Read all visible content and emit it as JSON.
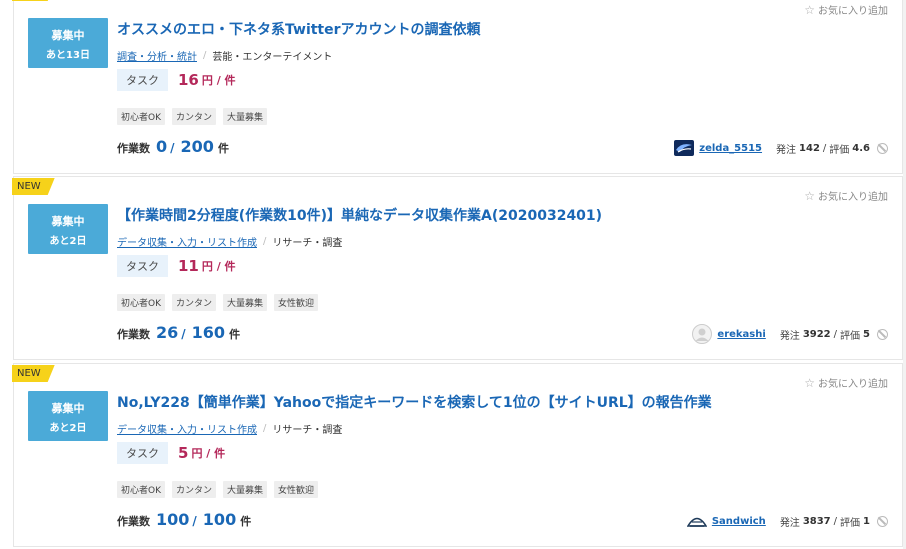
{
  "favorite_label": "お気に入り追加",
  "new_label": "NEW",
  "works_label": "作業数",
  "works_unit": "件",
  "posts_label": "発注",
  "rating_label": "評価",
  "jobs": [
    {
      "status": "募集中",
      "remaining": "あと13日",
      "title": "オススメのエロ・下ネタ系Twitterアカウントの調査依頼",
      "category_link": "調査・分析・統計",
      "category_plain": "芸能・エンターテイメント",
      "type": "タスク",
      "price": "16",
      "price_unit": "円 / 件",
      "tags": [
        "初心者OK",
        "カンタン",
        "大量募集"
      ],
      "works_done": "0",
      "works_total": "200",
      "client_name": "zelda_5515",
      "client_avatar": "zelda-logo-icon",
      "posts": "142",
      "rating": "4.6"
    },
    {
      "status": "募集中",
      "remaining": "あと2日",
      "title": "【作業時間2分程度(作業数10件)】単純なデータ収集作業A(2020032401)",
      "category_link": "データ収集・入力・リスト作成",
      "category_plain": "リサーチ・調査",
      "type": "タスク",
      "price": "11",
      "price_unit": "円 / 件",
      "tags": [
        "初心者OK",
        "カンタン",
        "大量募集",
        "女性歓迎"
      ],
      "works_done": "26",
      "works_total": "160",
      "client_name": "erekashi",
      "client_avatar": "default-user-icon",
      "posts": "3922",
      "rating": "5"
    },
    {
      "status": "募集中",
      "remaining": "あと2日",
      "title": "No,LY228【簡単作業】Yahooで指定キーワードを検索して1位の【サイトURL】の報告作業",
      "category_link": "データ収集・入力・リスト作成",
      "category_plain": "リサーチ・調査",
      "type": "タスク",
      "price": "5",
      "price_unit": "円 / 件",
      "tags": [
        "初心者OK",
        "カンタン",
        "大量募集",
        "女性歓迎"
      ],
      "works_done": "100",
      "works_total": "100",
      "client_name": "Sandwich",
      "client_avatar": "sandwich-logo-icon",
      "posts": "3837",
      "rating": "1"
    }
  ],
  "colors": {
    "status_bg": "#4baad8",
    "link": "#1a67b5",
    "price": "#b4285a",
    "new_badge": "#f6d21a"
  }
}
